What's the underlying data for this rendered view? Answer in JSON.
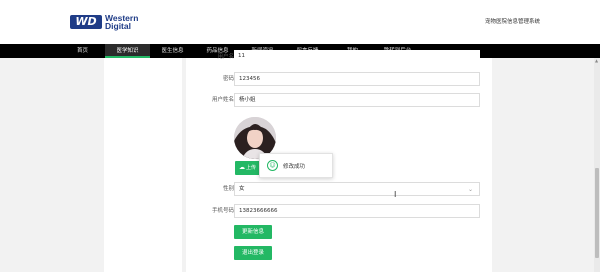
{
  "header": {
    "logo_mark": "WD",
    "logo_line1": "Western",
    "logo_line2": "Digital",
    "site_title": "宠物医院信息管理系统"
  },
  "nav": {
    "items": [
      {
        "label": "首页"
      },
      {
        "label": "医学知识"
      },
      {
        "label": "医生信息"
      },
      {
        "label": "药品信息"
      },
      {
        "label": "新闻资讯"
      },
      {
        "label": "留言反馈"
      },
      {
        "label": "我的"
      },
      {
        "label": "跳转到后台"
      }
    ],
    "active_index": 1
  },
  "form": {
    "username_label": "用户名",
    "username_value": "11",
    "password_label": "密码",
    "password_value": "123456",
    "name_label": "用户姓名",
    "name_value": "杨小姐",
    "upload_label": "上传",
    "gender_label": "性别",
    "gender_value": "女",
    "phone_label": "手机号码",
    "phone_value": "13823666666",
    "update_button": "更新信息",
    "logout_button": "退出登录"
  },
  "toast": {
    "message": "修改成功",
    "icon": "smile-icon"
  },
  "colors": {
    "accent": "#23b864",
    "nav_bg": "#000000",
    "logo_blue": "#1f3c87"
  }
}
